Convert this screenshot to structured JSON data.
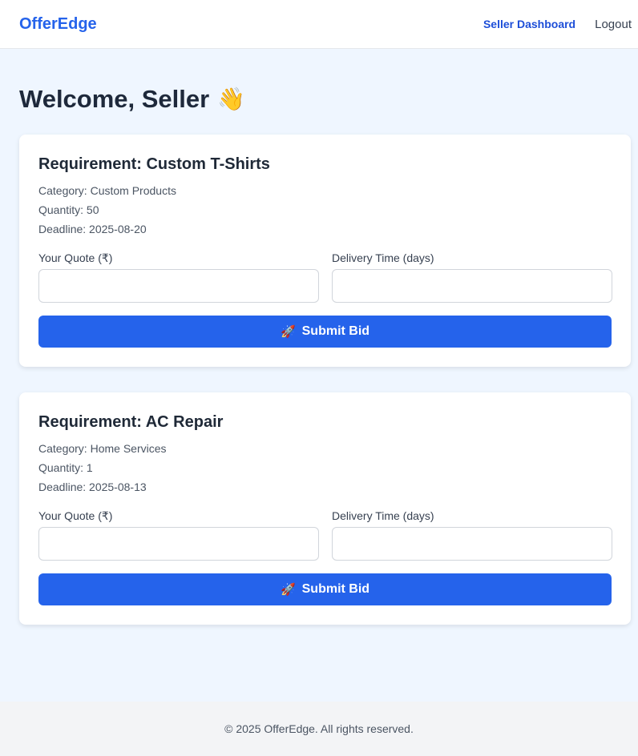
{
  "navbar": {
    "brand": "OfferEdge",
    "links": [
      "Seller Dashboard",
      "Logout"
    ]
  },
  "page": {
    "title": "Welcome, Seller",
    "title_icon": "waving-hand-icon"
  },
  "requirements": [
    {
      "title": "Requirement: Custom T-Shirts",
      "category": "Category: Custom Products",
      "quantity": "Quantity: 50",
      "deadline": "Deadline: 2025-08-20",
      "quote_label": "Your Quote (₹)",
      "quote_value": "",
      "delivery_label": "Delivery Time (days)",
      "delivery_value": "",
      "submit_label": "Submit Bid",
      "submit_icon": "rocket-icon"
    },
    {
      "title": "Requirement: AC Repair",
      "category": "Category: Home Services",
      "quantity": "Quantity: 1",
      "deadline": "Deadline: 2025-08-13",
      "quote_label": "Your Quote (₹)",
      "quote_value": "",
      "delivery_label": "Delivery Time (days)",
      "delivery_value": "",
      "submit_label": "Submit Bid",
      "submit_icon": "rocket-icon"
    }
  ],
  "footer": {
    "text": "© 2025 OfferEdge. All rights reserved."
  },
  "colors": {
    "brand": "#2563eb",
    "page_background": "#eff6ff",
    "card_background": "#ffffff",
    "footer_background": "#f3f4f6"
  }
}
